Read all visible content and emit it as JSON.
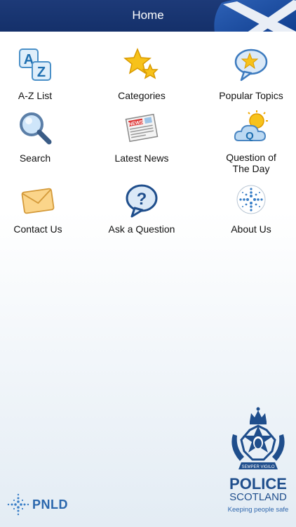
{
  "header": {
    "title": "Home"
  },
  "menu": [
    {
      "label": "A-Z List",
      "icon": "az-list-icon"
    },
    {
      "label": "Categories",
      "icon": "stars-icon"
    },
    {
      "label": "Popular Topics",
      "icon": "speech-bubble-star-icon"
    },
    {
      "label": "Search",
      "icon": "magnifier-icon"
    },
    {
      "label": "Latest News",
      "icon": "newspaper-icon"
    },
    {
      "label": "Question of\nThe Day",
      "icon": "sun-cloud-q-icon"
    },
    {
      "label": "Contact Us",
      "icon": "envelope-icon"
    },
    {
      "label": "Ask a Question",
      "icon": "question-bubble-icon"
    },
    {
      "label": "About Us",
      "icon": "globe-dots-icon"
    }
  ],
  "footer": {
    "pnld_text": "PNLD",
    "police_line1": "POLICE",
    "police_line2": "SCOTLAND",
    "police_tagline": "Keeping people safe",
    "motto": "SEMPER VIGILO"
  },
  "colors": {
    "navbar": "#1d3a78",
    "brand_blue": "#1f4e8c"
  }
}
